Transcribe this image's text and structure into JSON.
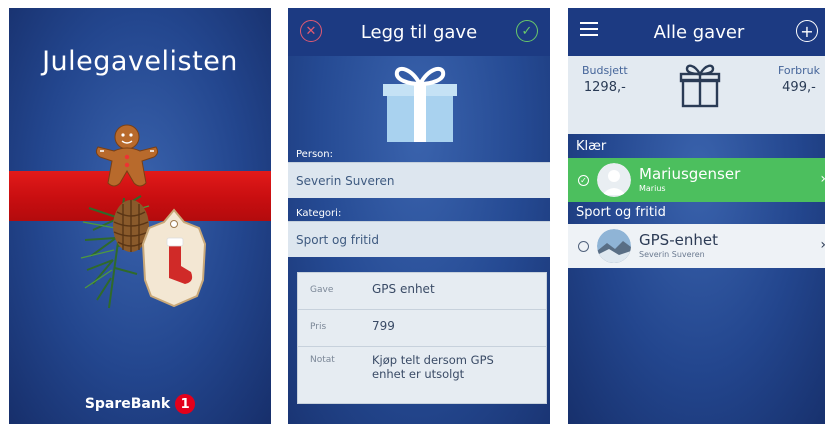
{
  "splash": {
    "title": "Julegavelisten",
    "brand": "SpareBank",
    "brand_logo": "1",
    "colors": {
      "ribbon": "#d11315",
      "background": "#23468e"
    },
    "decor_icons": [
      "gingerbread-man-icon",
      "pinecone-icon",
      "stocking-tag-icon"
    ]
  },
  "add_gift": {
    "title": "Legg til gave",
    "cancel_icon": "✕",
    "confirm_icon": "✓",
    "person_label": "Person:",
    "person_value": "Severin Suveren",
    "category_label": "Kategori:",
    "category_value": "Sport og fritid",
    "form": {
      "gift_label": "Gave",
      "gift_value": "GPS enhet",
      "price_label": "Pris",
      "price_value": "799",
      "note_label": "Notat",
      "note_value": "Kjøp telt dersom GPS enhet er utsolgt"
    }
  },
  "gift_list": {
    "title": "Alle gaver",
    "add_icon": "+",
    "budget_label": "Budsjett",
    "budget_value": "1298,-",
    "spend_label": "Forbruk",
    "spend_value": "499,-",
    "categories": [
      {
        "name": "Klær",
        "items": [
          {
            "name": "Mariusgenser",
            "person": "Marius",
            "done": true
          }
        ]
      },
      {
        "name": "Sport og fritid",
        "items": [
          {
            "name": "GPS-enhet",
            "person": "Severin Suveren",
            "done": false
          }
        ]
      }
    ],
    "colors": {
      "done_row": "#4cbf5e"
    }
  }
}
